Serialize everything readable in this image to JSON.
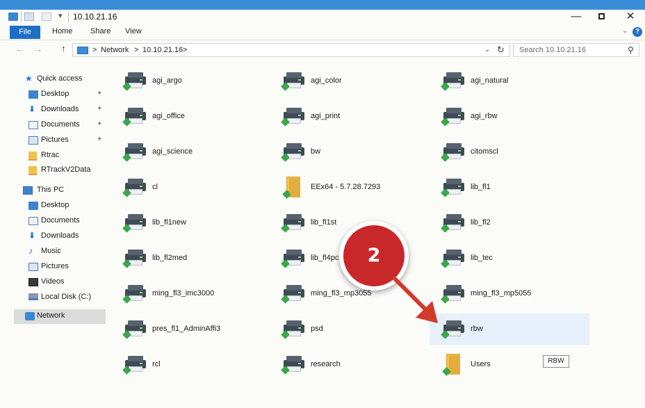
{
  "window": {
    "title": "10.10.21.16",
    "minimize": "—",
    "close": "✕"
  },
  "ribbon": {
    "file": "File",
    "home": "Home",
    "share": "Share",
    "view": "View",
    "expand": "⌄",
    "help": "?"
  },
  "address": {
    "back": "←",
    "forward": "→",
    "up": "↑",
    "sep": ">",
    "crumb1": "Network",
    "crumb2": "10.10.21.16",
    "dropdown": "⌄",
    "refresh": "↻",
    "search_placeholder": "Search 10.10.21.16",
    "search_icon": "⚲"
  },
  "nav": {
    "quick_access": "Quick access",
    "desktop": "Desktop",
    "downloads": "Downloads",
    "documents": "Documents",
    "pictures": "Pictures",
    "rtrac": "Rtrac",
    "rtrackv2data": "RTrackV2Data",
    "this_pc": "This PC",
    "pc_desktop": "Desktop",
    "pc_documents": "Documents",
    "pc_downloads": "Downloads",
    "pc_music": "Music",
    "pc_pictures": "Pictures",
    "pc_videos": "Videos",
    "pc_local_disk": "Local Disk (C:)",
    "network": "Network",
    "pin": "✦"
  },
  "files": {
    "col1": [
      "agi_argo",
      "agi_office",
      "agi_science",
      "cl",
      "lib_fl1new",
      "lib_fl2med",
      "ming_fl3_imc3000",
      "pres_fl1_AdminAffi3",
      "rcl"
    ],
    "col2": [
      "agi_color",
      "agi_print",
      "bw",
      "EEx64 - 5.7.28.7293",
      "lib_fl1st",
      "lib_fl4pc",
      "ming_fl3_mp3055",
      "psd",
      "research"
    ],
    "col3": [
      "agi_natural",
      "agi_rbw",
      "citomscl",
      "lib_fl1",
      "lib_fl2",
      "lib_tec",
      "ming_fl3_mp5055",
      "rbw",
      "Users"
    ]
  },
  "badge": "RBW",
  "annotation": {
    "step": "2"
  },
  "colors": {
    "accent": "#1e6fc7",
    "callout": "#c9282a",
    "selection": "#e6f1fb"
  }
}
